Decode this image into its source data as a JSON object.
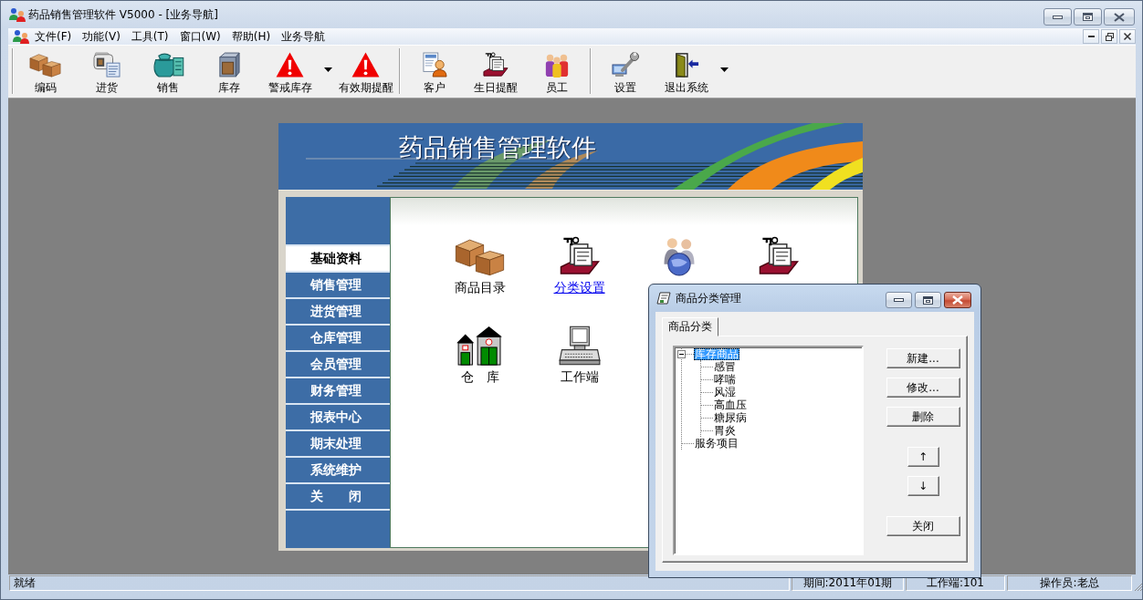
{
  "window": {
    "title": "药品销售管理软件 V5000 - [业务导航]"
  },
  "menu_bar": {
    "items": [
      "文件(F)",
      "功能(V)",
      "工具(T)",
      "窗口(W)",
      "帮助(H)",
      "业务导航"
    ]
  },
  "toolbar": {
    "items": [
      {
        "kind": "button",
        "label": "编码"
      },
      {
        "kind": "button",
        "label": "进货"
      },
      {
        "kind": "button",
        "label": "销售"
      },
      {
        "kind": "button",
        "label": "库存"
      },
      {
        "kind": "dropdown",
        "label": "警戒库存"
      },
      {
        "kind": "button",
        "label": "有效期提醒"
      },
      {
        "kind": "separator"
      },
      {
        "kind": "button",
        "label": "客户"
      },
      {
        "kind": "button",
        "label": "生日提醒"
      },
      {
        "kind": "button",
        "label": "员工"
      },
      {
        "kind": "separator"
      },
      {
        "kind": "button",
        "label": "设置"
      },
      {
        "kind": "dropdown",
        "label": "退出系统"
      }
    ]
  },
  "navigator": {
    "banner_title": "药品销售管理软件",
    "sidebar": [
      {
        "label": "基础资料",
        "selected": true
      },
      {
        "label": "销售管理",
        "selected": false
      },
      {
        "label": "进货管理",
        "selected": false
      },
      {
        "label": "仓库管理",
        "selected": false
      },
      {
        "label": "会员管理",
        "selected": false
      },
      {
        "label": "财务管理",
        "selected": false
      },
      {
        "label": "报表中心",
        "selected": false
      },
      {
        "label": "期末处理",
        "selected": false
      },
      {
        "label": "系统维护",
        "selected": false
      },
      {
        "label": "关　　闭",
        "selected": false
      }
    ],
    "shortcuts": [
      {
        "kind": "labeled",
        "label": "商品目录",
        "highlighted": false
      },
      {
        "kind": "labeled",
        "label": "分类设置",
        "highlighted": true
      },
      {
        "kind": "icon"
      },
      {
        "kind": "icon"
      },
      {
        "kind": "labeled",
        "label": "仓　库",
        "highlighted": false
      },
      {
        "kind": "labeled",
        "label": "工作端",
        "highlighted": false
      }
    ]
  },
  "dialog": {
    "title": "商品分类管理",
    "tabs": [
      {
        "label": "商品分类",
        "selected": true
      }
    ],
    "tree": [
      {
        "label": "库存商品",
        "selected": true,
        "expanded": true,
        "children": [
          {
            "label": "感冒",
            "selected": false
          },
          {
            "label": "哮喘",
            "selected": false
          },
          {
            "label": "风湿",
            "selected": false
          },
          {
            "label": "高血压",
            "selected": false
          },
          {
            "label": "糖尿病",
            "selected": false
          },
          {
            "label": "胃炎",
            "selected": false
          }
        ]
      },
      {
        "label": "服务项目",
        "selected": false
      }
    ],
    "buttons": [
      {
        "label": "新建...",
        "kind": "text"
      },
      {
        "label": "修改...",
        "kind": "text"
      },
      {
        "label": "删除",
        "kind": "text"
      },
      {
        "label": "↑",
        "kind": "arrow"
      },
      {
        "label": "↓",
        "kind": "arrow"
      },
      {
        "label": "关闭",
        "kind": "text"
      }
    ]
  },
  "status_bar": {
    "panels": [
      "就绪",
      "期间:2011年01期",
      "工作端:101",
      "操作员:老总"
    ]
  }
}
